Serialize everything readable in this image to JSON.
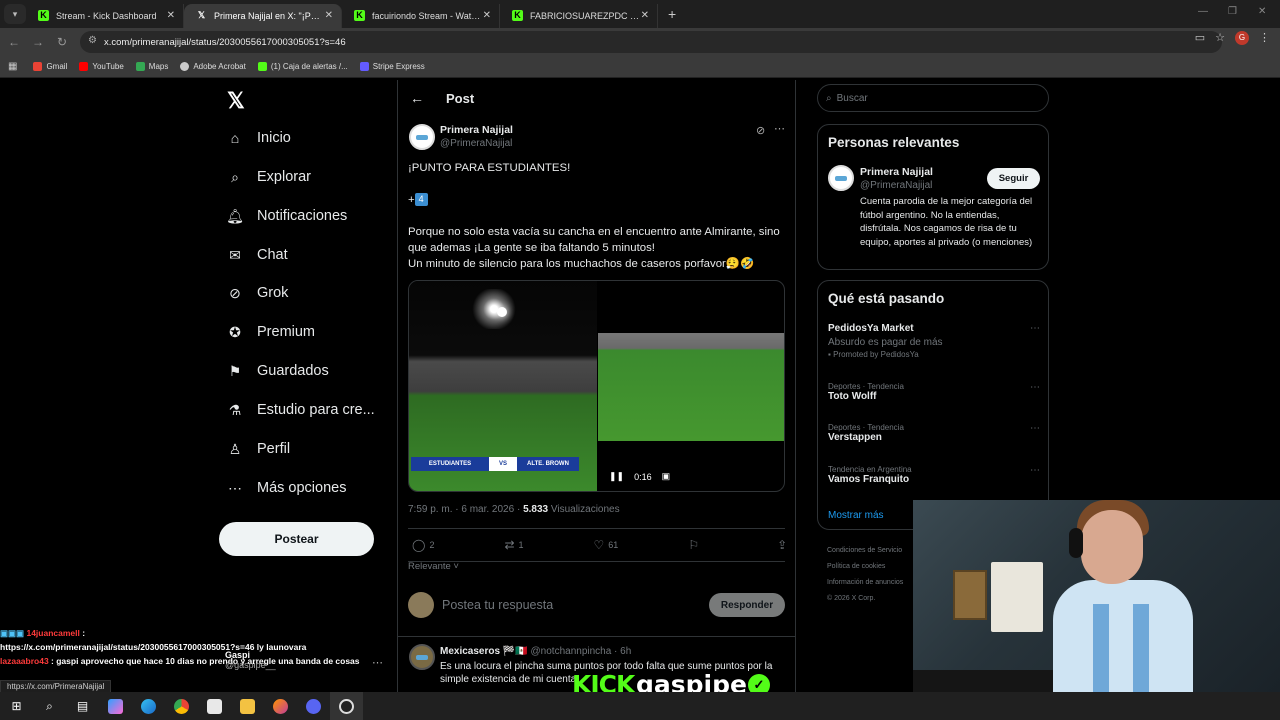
{
  "tabs": [
    {
      "title": "Stream - Kick Dashboard",
      "favicon": "kick-icon",
      "active": false
    },
    {
      "title": "Primera Najijal en X: \"¡PUNTO PARA ESTUDIANTES!\"",
      "favicon": "x-icon",
      "active": true
    },
    {
      "title": "facuiriondo Stream - Watch Live",
      "favicon": "kick-icon",
      "active": false
    },
    {
      "title": "FABRICIOSUAREZPDC Stream",
      "favicon": "kick-icon",
      "active": false
    }
  ],
  "address_bar": {
    "url": "x.com/primeranajijal/status/2030055617000305051?s=46"
  },
  "bookmarks": [
    {
      "label": "Gmail",
      "color": "#ea4335"
    },
    {
      "label": "YouTube",
      "color": "#ff0000"
    },
    {
      "label": "Maps",
      "color": "#34a853"
    },
    {
      "label": "Adobe Acrobat",
      "color": "#cccccc"
    },
    {
      "label": "(1) Caja de alertas /...",
      "color": "#53fc18"
    },
    {
      "label": "Stripe Express",
      "color": "#635bff"
    }
  ],
  "sidebar": {
    "items": [
      {
        "label": "Inicio",
        "icon": "home-icon"
      },
      {
        "label": "Explorar",
        "icon": "search-icon"
      },
      {
        "label": "Notificaciones",
        "icon": "bell-icon"
      },
      {
        "label": "Chat",
        "icon": "mail-icon"
      },
      {
        "label": "Grok",
        "icon": "grok-icon"
      },
      {
        "label": "Premium",
        "icon": "verified-icon"
      },
      {
        "label": "Guardados",
        "icon": "bookmark-icon"
      },
      {
        "label": "Estudio para cre...",
        "icon": "flask-icon"
      },
      {
        "label": "Perfil",
        "icon": "person-icon"
      },
      {
        "label": "Más opciones",
        "icon": "more-icon"
      }
    ],
    "post_button": "Postear"
  },
  "post": {
    "header": "Post",
    "author_name": "Primera Najijal",
    "author_handle": "@PrimeraNajijal",
    "text_line1": "¡PUNTO PARA ESTUDIANTES!",
    "text_line2_prefix": "+",
    "text_line2_keycap": "4",
    "text_para": "Porque no solo esta vacía su cancha en el encuentro ante Almirante, sino que ademas ¡La gente se iba faltando 5 minutos!",
    "text_para2": "Un minuto de silencio para los muchachos de caseros porfavor😮‍💨🤣",
    "scoreboard_team_a": "ESTUDIANTES",
    "scoreboard_vs": "VS",
    "scoreboard_team_b": "ALTE. BROWN",
    "video_time": "0:16",
    "timestamp": "7:59 p. m. · 6 mar. 2026 ·",
    "views": "5.833",
    "views_label": "Visualizaciones",
    "replies": "2",
    "reposts": "1",
    "likes": "61",
    "sort_label": "Relevante",
    "reply_placeholder": "Postea tu respuesta",
    "reply_button": "Responder"
  },
  "reply": {
    "author": "Mexicaseros 🏁🇲🇽",
    "handle_time": "@notchannpincha · 6h",
    "text": "Es una locura el pincha suma puntos por todo falta que sume puntos por la simple existencia de mi cuenta"
  },
  "right": {
    "search_placeholder": "Buscar",
    "relevant_title": "Personas relevantes",
    "relevant_name": "Primera Najijal",
    "relevant_handle": "@PrimeraNajijal",
    "follow": "Seguir",
    "bio": "Cuenta parodia de la mejor categoría del fútbol argentino. No la entiendas, disfrútala. Nos cagamos de risa de tu equipo, aportes al privado (o menciones)",
    "trending_title": "Qué está pasando",
    "trends": [
      {
        "context": "",
        "name": "PedidosYa Market",
        "sub": "Absurdo es pagar de más",
        "promo": "Promoted by PedidosYa"
      },
      {
        "context": "Deportes · Tendencia",
        "name": "Toto Wolff"
      },
      {
        "context": "Deportes · Tendencia",
        "name": "Verstappen"
      },
      {
        "context": "Tendencia en Argentina",
        "name": "Vamos Franquito"
      }
    ],
    "show_more": "Mostrar más",
    "footer1": "Condiciones de Servicio",
    "footer2": "Política de cookies",
    "footer3": "Información de anuncios",
    "copyright": "© 2026 X Corp."
  },
  "stream_overlay": {
    "chat1_user": "14juancamell",
    "chat1_text": "https://x.com/primeranajijal/status/2030055617000305051?s=46 ly launovara",
    "chat2_user": "lazaaabro43",
    "chat2_text": ": gaspi aprovecho que hace 10 dias no prendo y arregle una banda de cosas",
    "overlay_name": "Gaspi",
    "overlay_handle": "@gaspipe__",
    "kick_logo": "KICK",
    "kick_channel": "gaspipe"
  },
  "status_url": "https://x.com/PrimeraNajijal"
}
